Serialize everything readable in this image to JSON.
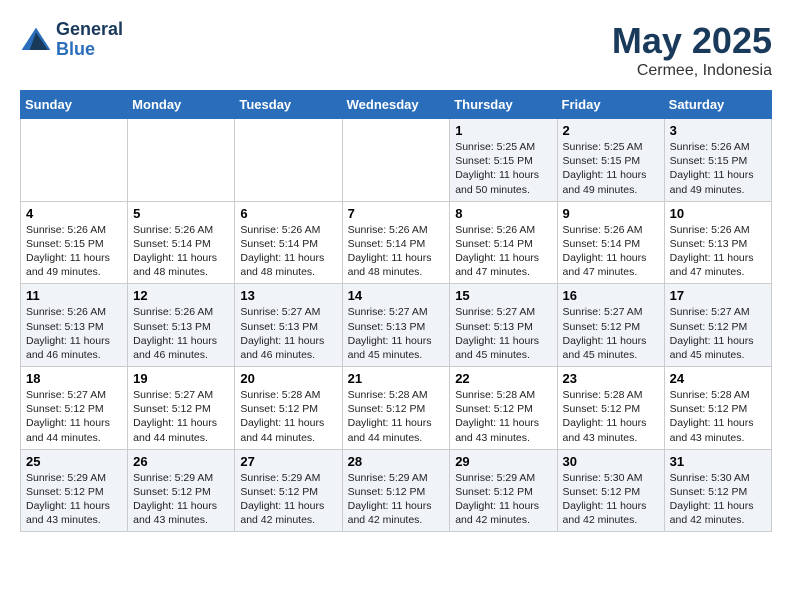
{
  "header": {
    "logo_line1": "General",
    "logo_line2": "Blue",
    "month": "May 2025",
    "location": "Cermee, Indonesia"
  },
  "days_of_week": [
    "Sunday",
    "Monday",
    "Tuesday",
    "Wednesday",
    "Thursday",
    "Friday",
    "Saturday"
  ],
  "weeks": [
    [
      {
        "day": "",
        "info": ""
      },
      {
        "day": "",
        "info": ""
      },
      {
        "day": "",
        "info": ""
      },
      {
        "day": "",
        "info": ""
      },
      {
        "day": "1",
        "info": "Sunrise: 5:25 AM\nSunset: 5:15 PM\nDaylight: 11 hours\nand 50 minutes."
      },
      {
        "day": "2",
        "info": "Sunrise: 5:25 AM\nSunset: 5:15 PM\nDaylight: 11 hours\nand 49 minutes."
      },
      {
        "day": "3",
        "info": "Sunrise: 5:26 AM\nSunset: 5:15 PM\nDaylight: 11 hours\nand 49 minutes."
      }
    ],
    [
      {
        "day": "4",
        "info": "Sunrise: 5:26 AM\nSunset: 5:15 PM\nDaylight: 11 hours\nand 49 minutes."
      },
      {
        "day": "5",
        "info": "Sunrise: 5:26 AM\nSunset: 5:14 PM\nDaylight: 11 hours\nand 48 minutes."
      },
      {
        "day": "6",
        "info": "Sunrise: 5:26 AM\nSunset: 5:14 PM\nDaylight: 11 hours\nand 48 minutes."
      },
      {
        "day": "7",
        "info": "Sunrise: 5:26 AM\nSunset: 5:14 PM\nDaylight: 11 hours\nand 48 minutes."
      },
      {
        "day": "8",
        "info": "Sunrise: 5:26 AM\nSunset: 5:14 PM\nDaylight: 11 hours\nand 47 minutes."
      },
      {
        "day": "9",
        "info": "Sunrise: 5:26 AM\nSunset: 5:14 PM\nDaylight: 11 hours\nand 47 minutes."
      },
      {
        "day": "10",
        "info": "Sunrise: 5:26 AM\nSunset: 5:13 PM\nDaylight: 11 hours\nand 47 minutes."
      }
    ],
    [
      {
        "day": "11",
        "info": "Sunrise: 5:26 AM\nSunset: 5:13 PM\nDaylight: 11 hours\nand 46 minutes."
      },
      {
        "day": "12",
        "info": "Sunrise: 5:26 AM\nSunset: 5:13 PM\nDaylight: 11 hours\nand 46 minutes."
      },
      {
        "day": "13",
        "info": "Sunrise: 5:27 AM\nSunset: 5:13 PM\nDaylight: 11 hours\nand 46 minutes."
      },
      {
        "day": "14",
        "info": "Sunrise: 5:27 AM\nSunset: 5:13 PM\nDaylight: 11 hours\nand 45 minutes."
      },
      {
        "day": "15",
        "info": "Sunrise: 5:27 AM\nSunset: 5:13 PM\nDaylight: 11 hours\nand 45 minutes."
      },
      {
        "day": "16",
        "info": "Sunrise: 5:27 AM\nSunset: 5:12 PM\nDaylight: 11 hours\nand 45 minutes."
      },
      {
        "day": "17",
        "info": "Sunrise: 5:27 AM\nSunset: 5:12 PM\nDaylight: 11 hours\nand 45 minutes."
      }
    ],
    [
      {
        "day": "18",
        "info": "Sunrise: 5:27 AM\nSunset: 5:12 PM\nDaylight: 11 hours\nand 44 minutes."
      },
      {
        "day": "19",
        "info": "Sunrise: 5:27 AM\nSunset: 5:12 PM\nDaylight: 11 hours\nand 44 minutes."
      },
      {
        "day": "20",
        "info": "Sunrise: 5:28 AM\nSunset: 5:12 PM\nDaylight: 11 hours\nand 44 minutes."
      },
      {
        "day": "21",
        "info": "Sunrise: 5:28 AM\nSunset: 5:12 PM\nDaylight: 11 hours\nand 44 minutes."
      },
      {
        "day": "22",
        "info": "Sunrise: 5:28 AM\nSunset: 5:12 PM\nDaylight: 11 hours\nand 43 minutes."
      },
      {
        "day": "23",
        "info": "Sunrise: 5:28 AM\nSunset: 5:12 PM\nDaylight: 11 hours\nand 43 minutes."
      },
      {
        "day": "24",
        "info": "Sunrise: 5:28 AM\nSunset: 5:12 PM\nDaylight: 11 hours\nand 43 minutes."
      }
    ],
    [
      {
        "day": "25",
        "info": "Sunrise: 5:29 AM\nSunset: 5:12 PM\nDaylight: 11 hours\nand 43 minutes."
      },
      {
        "day": "26",
        "info": "Sunrise: 5:29 AM\nSunset: 5:12 PM\nDaylight: 11 hours\nand 43 minutes."
      },
      {
        "day": "27",
        "info": "Sunrise: 5:29 AM\nSunset: 5:12 PM\nDaylight: 11 hours\nand 42 minutes."
      },
      {
        "day": "28",
        "info": "Sunrise: 5:29 AM\nSunset: 5:12 PM\nDaylight: 11 hours\nand 42 minutes."
      },
      {
        "day": "29",
        "info": "Sunrise: 5:29 AM\nSunset: 5:12 PM\nDaylight: 11 hours\nand 42 minutes."
      },
      {
        "day": "30",
        "info": "Sunrise: 5:30 AM\nSunset: 5:12 PM\nDaylight: 11 hours\nand 42 minutes."
      },
      {
        "day": "31",
        "info": "Sunrise: 5:30 AM\nSunset: 5:12 PM\nDaylight: 11 hours\nand 42 minutes."
      }
    ]
  ]
}
